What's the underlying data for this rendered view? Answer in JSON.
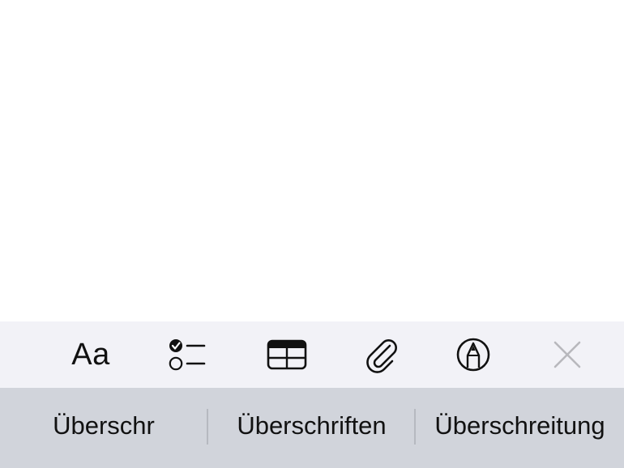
{
  "toolbar": {
    "format_label": "Aa",
    "icons": {
      "format": "text-format-icon",
      "checklist": "checklist-icon",
      "table": "table-icon",
      "attach": "paperclip-icon",
      "markup": "markup-pen-icon",
      "close": "close-icon"
    }
  },
  "suggestions": {
    "items": [
      "Überschr",
      "Überschriften",
      "Überschreitung"
    ]
  },
  "colors": {
    "toolbar_bg": "#f2f2f7",
    "suggestion_bar_bg": "#d1d4db",
    "icon": "#111111",
    "close_icon": "#b8b8bd"
  }
}
